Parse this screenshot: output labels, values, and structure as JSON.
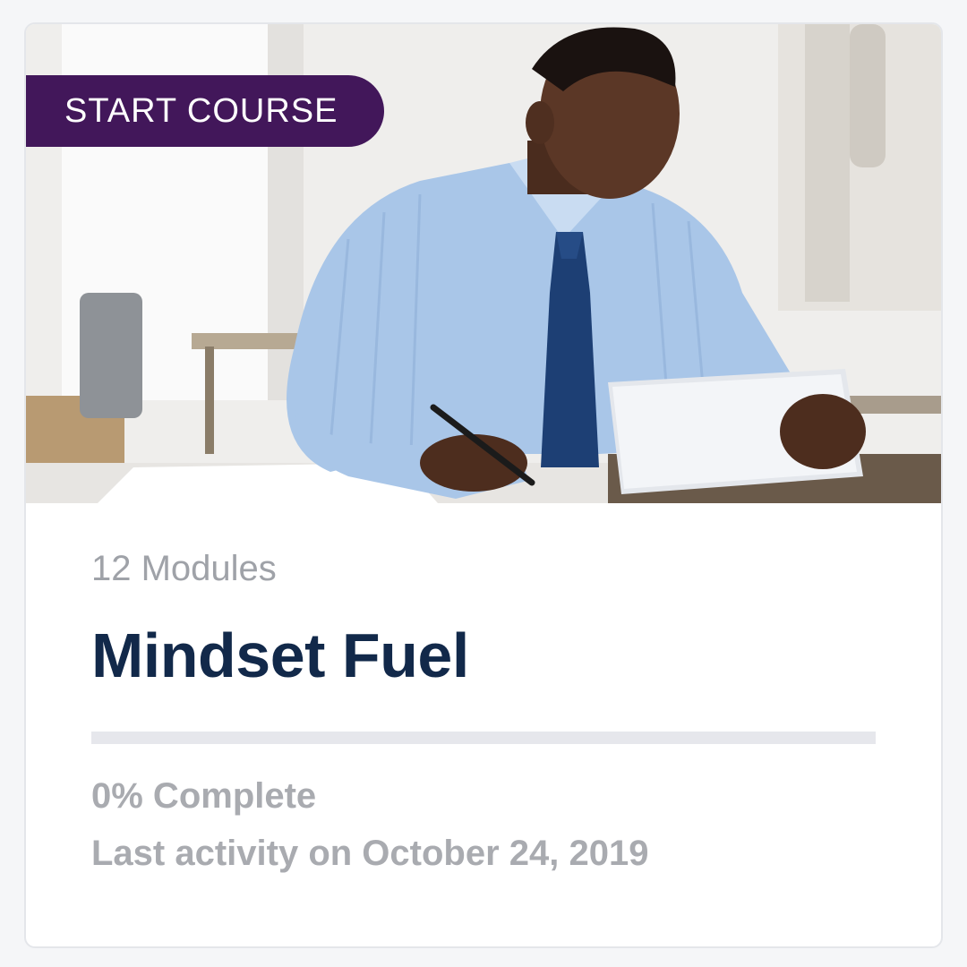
{
  "course_card": {
    "badge_label": "START COURSE",
    "modules_text": "12 Modules",
    "title": "Mindset Fuel",
    "progress_fraction": 0,
    "progress_text": "0% Complete",
    "last_activity_text": "Last activity on October 24, 2019",
    "image_semantic": "man-in-shirt-and-tie-holding-tablet-at-desk",
    "colors": {
      "badge_bg": "#42175a",
      "title": "#12294a",
      "muted_text": "#a9abb0",
      "track": "#e6e7ec"
    }
  }
}
